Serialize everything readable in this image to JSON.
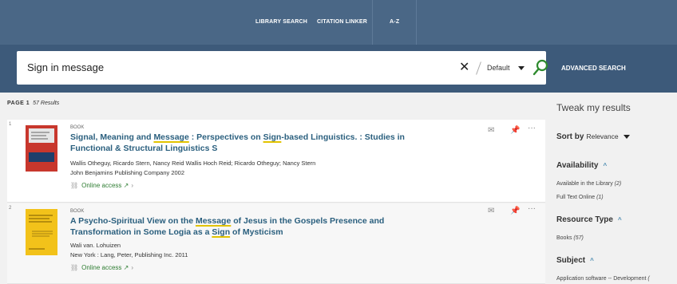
{
  "nav": {
    "library_search": "LIBRARY SEARCH",
    "citation_linker": "CITATION LINKER",
    "a_z": "A-Z"
  },
  "search": {
    "query": "Sign in message",
    "clear": "✕",
    "scope": "Default",
    "advanced": "ADVANCED SEARCH"
  },
  "results": {
    "page_label": "PAGE 1",
    "count_label": "57 Results",
    "items": [
      {
        "index": "1",
        "type": "BOOK",
        "title_parts": [
          {
            "t": "Signal, Meaning and "
          },
          {
            "t": "Message",
            "hl": true
          },
          {
            "t": " : Perspectives on "
          },
          {
            "t": "Sign",
            "hl": true
          },
          {
            "t": "-based Linguistics. : Studies in Functional & Structural Linguistics S"
          }
        ],
        "authors": "Wallis Otheguy, Ricardo Stern, Nancy Reid Wallis Hoch Reid; Ricardo Otheguy; Nancy Stern",
        "publisher": "John Benjamins Publishing Company 2002",
        "access": "Online access",
        "cover_color": "#c8372d",
        "cover_text": "Signal, Meaning and Message"
      },
      {
        "index": "2",
        "type": "BOOK",
        "title_parts": [
          {
            "t": "A Psycho-Spiritual View on the "
          },
          {
            "t": "Message",
            "hl": true
          },
          {
            "t": " of Jesus in the Gospels Presence and Transformation in Some Logia as a "
          },
          {
            "t": "Sign",
            "hl": true
          },
          {
            "t": " of Mysticism"
          }
        ],
        "authors": "Wali van. Lohuizen",
        "publisher": "New York : Lang, Peter, Publishing Inc. 2011",
        "access": "Online access",
        "cover_color": "#f2c21a",
        "cover_text": "A Psycho-Spiritual View on the Message of Jesus in the Gospels"
      }
    ]
  },
  "sidebar": {
    "title": "Tweak my results",
    "sort_label": "Sort by",
    "sort_value": "Relevance",
    "facets": [
      {
        "label": "Availability",
        "options": [
          {
            "text": "Available in the Library",
            "count": "(2)"
          },
          {
            "text": "Full Text Online",
            "count": "(1)"
          }
        ]
      },
      {
        "label": "Resource Type",
        "options": [
          {
            "text": "Books",
            "count": "(57)"
          }
        ]
      },
      {
        "label": "Subject",
        "options": [
          {
            "text": "Application software -- Development",
            "count": "("
          }
        ]
      }
    ]
  },
  "colors": {
    "nav_bg": "#4a6786",
    "search_bg": "#3d5a7a",
    "title_link": "#2a5f7e",
    "access_green": "#2e7d32",
    "highlight": "#e2c300"
  }
}
